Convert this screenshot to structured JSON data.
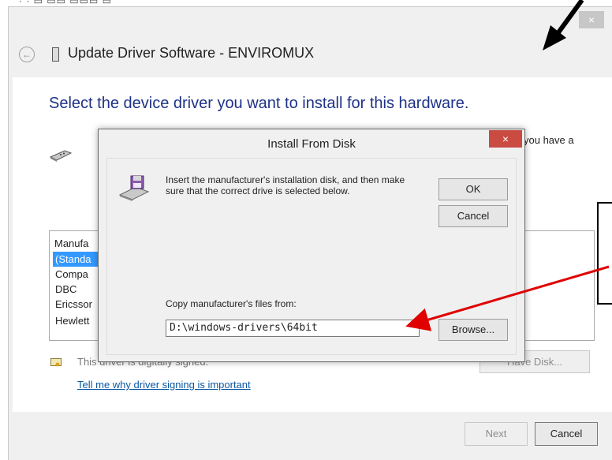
{
  "wizard": {
    "title": "Update Driver Software - ENVIROMUX",
    "close_glyph": "×",
    "back_glyph": "←",
    "headline": "Select the device driver you want to install for this hardware.",
    "partial_right_text": "you have a",
    "list": {
      "header_fragment": "Manufa",
      "items": [
        "(Standa",
        "Compa",
        "DBC",
        "Ericssor",
        "Hewlett"
      ]
    },
    "signed_text": "This driver is digitally signed.",
    "signing_link": "Tell me why driver signing is important",
    "have_disk_label": "Have Disk...",
    "next_label": "Next",
    "cancel_label": "Cancel"
  },
  "dialog": {
    "title": "Install From Disk",
    "close_glyph": "×",
    "message": "Insert the manufacturer's installation disk, and then make sure that the correct drive is selected below.",
    "ok_label": "OK",
    "cancel_label": "Cancel",
    "copy_label": "Copy manufacturer's files from:",
    "path_value": "D:\\windows-drivers\\64bit",
    "browse_label": "Browse..."
  },
  "colors": {
    "headline": "#1e3287",
    "link": "#0a57a4",
    "selection": "#3399ff",
    "dialog_close": "#c94b42",
    "annotation_arrow_red": "#e00000",
    "annotation_arrow_black": "#000000"
  }
}
